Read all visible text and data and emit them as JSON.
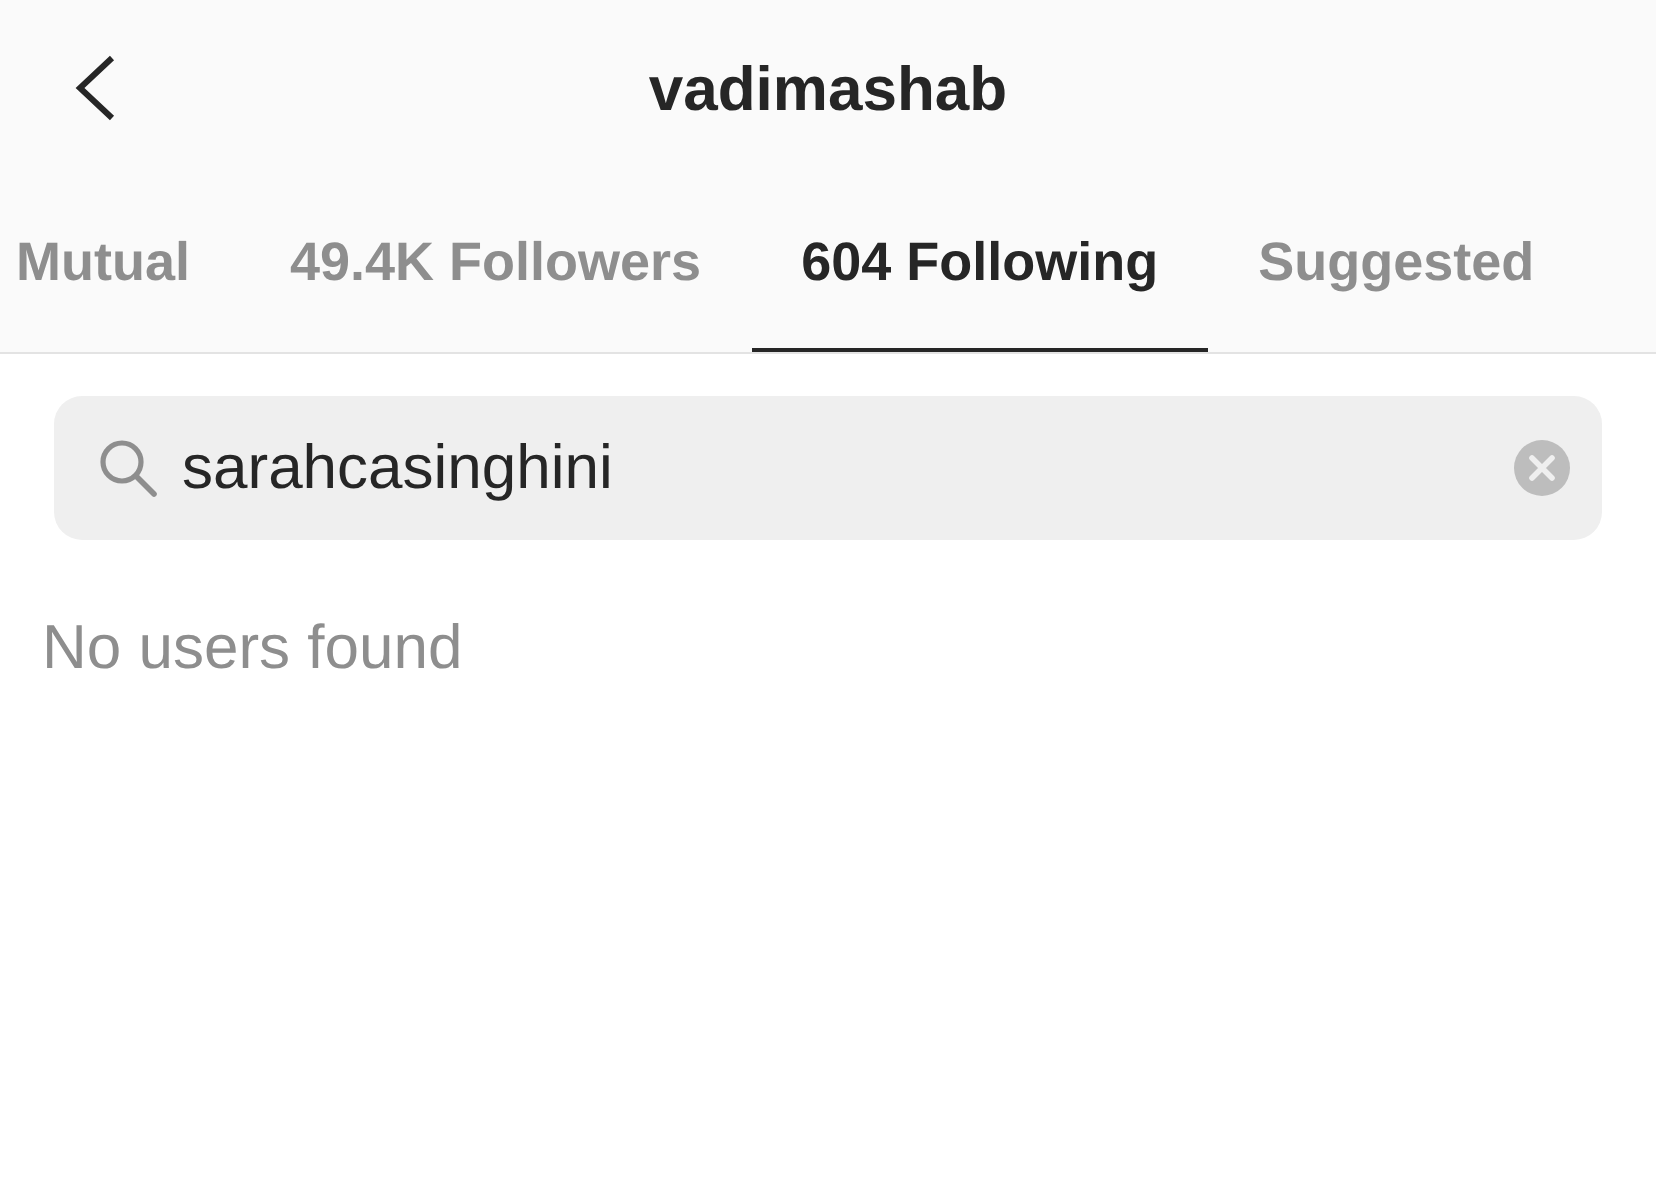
{
  "header": {
    "title": "vadimashab"
  },
  "tabs": [
    {
      "label": "Mutual",
      "selected": false
    },
    {
      "label": "49.4K Followers",
      "selected": false
    },
    {
      "label": "604 Following",
      "selected": true
    },
    {
      "label": "Suggested",
      "selected": false
    }
  ],
  "search": {
    "value": "sarahcasinghini"
  },
  "message": "No users found"
}
